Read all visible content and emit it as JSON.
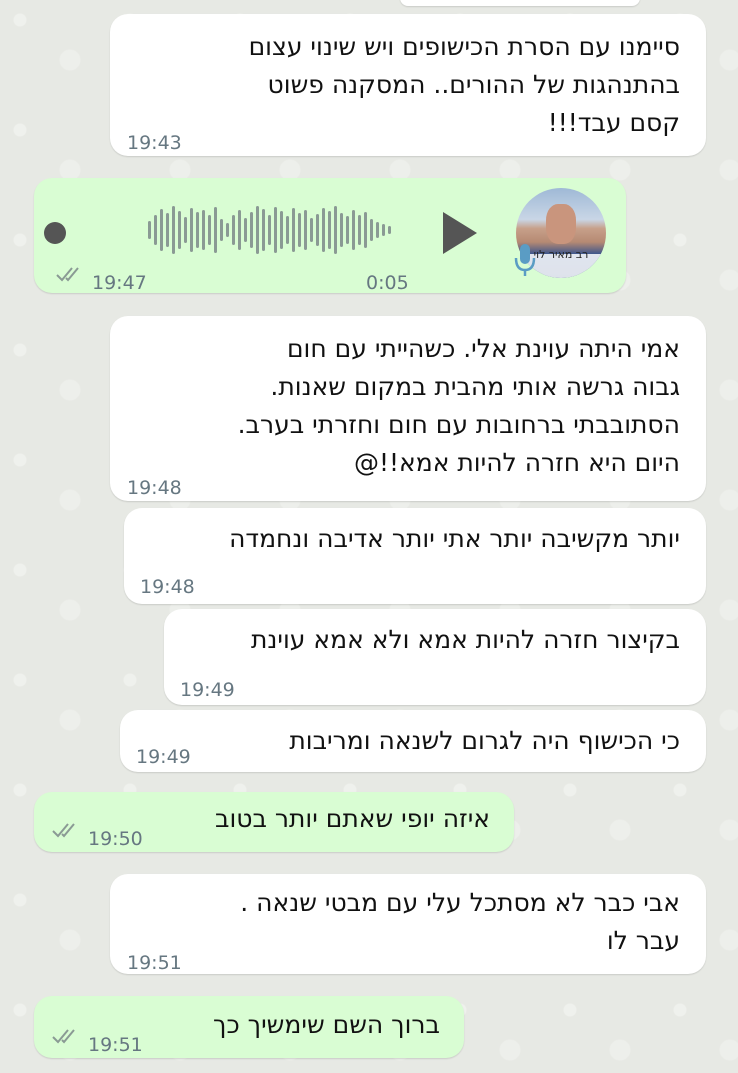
{
  "messages": [
    {
      "id": "m1",
      "dir": "in",
      "lines": [
        "סיימנו עם הסרת הכישופים ויש שינוי  עצום",
        "בהתנהגות של ההורים.. המסקנה  פשוט",
        "קסם עבד!!!"
      ],
      "time": "19:43"
    },
    {
      "id": "m2",
      "dir": "out",
      "type": "voice",
      "duration": "0:05",
      "time": "19:47",
      "avatar_caption": "רב מאיר לוי"
    },
    {
      "id": "m3",
      "dir": "in",
      "lines": [
        "אמי היתה עוינת אלי. כשהייתי עם חום",
        "גבוה גרשה אותי מהבית במקום שאנות.",
        "הסתובבתי ברחובות עם חום וחזרתי בערב.",
        "היום היא חזרה להיות אמא!!@"
      ],
      "time": "19:48"
    },
    {
      "id": "m4",
      "dir": "in",
      "lines": [
        "יותר מקשיבה יותר אתי יותר אדיבה ונחמדה"
      ],
      "time": "19:48"
    },
    {
      "id": "m5",
      "dir": "in",
      "lines": [
        "בקיצור חזרה להיות אמא ולא אמא עוינת"
      ],
      "time": "19:49"
    },
    {
      "id": "m6",
      "dir": "in",
      "lines": [
        "כי הכישוף היה לגרום לשנאה ומריבות"
      ],
      "time": "19:49"
    },
    {
      "id": "m7",
      "dir": "out",
      "lines": [
        "איזה יופי שאתם יותר בטוב"
      ],
      "time": "19:50"
    },
    {
      "id": "m8",
      "dir": "in",
      "lines": [
        "אבי כבר לא מסתכל עלי עם מבטי שנאה .",
        "עבר לו"
      ],
      "time": "19:51"
    },
    {
      "id": "m9",
      "dir": "out",
      "lines": [
        "ברוך השם שימשיך כך"
      ],
      "time": "19:51"
    }
  ],
  "colors": {
    "incoming": "#ffffff",
    "outgoing": "#d9fdd3",
    "wallpaper": "#e7e9e4",
    "time": "#667781",
    "ticks": "#8a9a94"
  },
  "icons": {
    "play": "play-icon",
    "mic": "microphone-icon",
    "read": "double-check-icon"
  }
}
